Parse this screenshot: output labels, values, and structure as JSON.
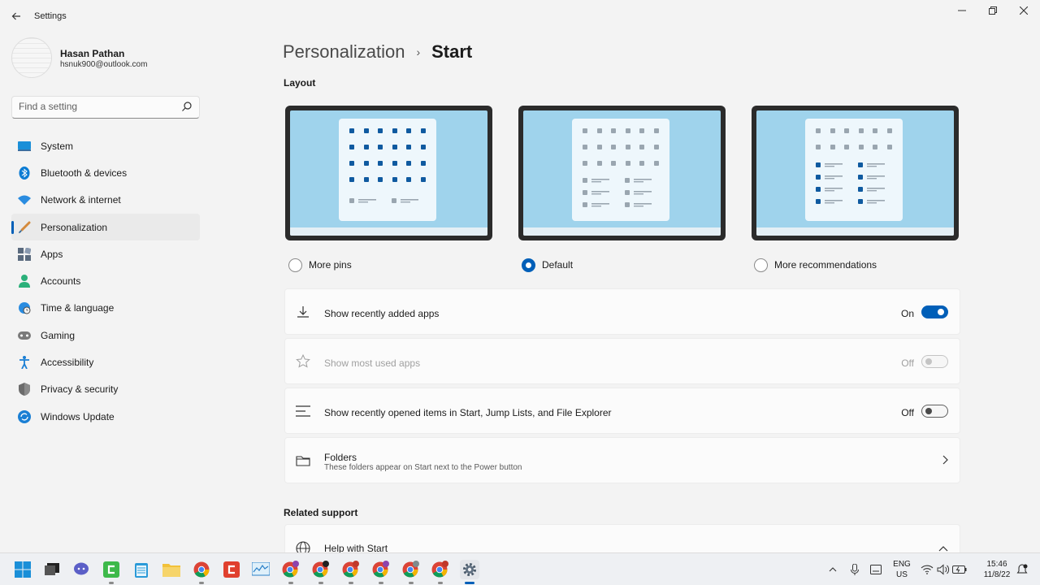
{
  "app": {
    "title": "Settings"
  },
  "profile": {
    "name": "Hasan Pathan",
    "email": "hsnuk900@outlook.com"
  },
  "search": {
    "placeholder": "Find a setting"
  },
  "sidebar": {
    "items": [
      {
        "label": "System",
        "icon": "monitor-icon",
        "color": "#1a8fd8"
      },
      {
        "label": "Bluetooth & devices",
        "icon": "bluetooth-icon",
        "color": "#0a7bd3"
      },
      {
        "label": "Network & internet",
        "icon": "wifi-icon",
        "color": "#2a8ce0"
      },
      {
        "label": "Personalization",
        "icon": "brush-icon",
        "color": "#d48a3c",
        "active": true
      },
      {
        "label": "Apps",
        "icon": "apps-icon",
        "color": "#5a6a7e"
      },
      {
        "label": "Accounts",
        "icon": "person-icon",
        "color": "#2bb07a"
      },
      {
        "label": "Time & language",
        "icon": "globe-clock-icon",
        "color": "#2a8ce0"
      },
      {
        "label": "Gaming",
        "icon": "gamepad-icon",
        "color": "#7a7a7a"
      },
      {
        "label": "Accessibility",
        "icon": "accessibility-icon",
        "color": "#1a7fd4"
      },
      {
        "label": "Privacy & security",
        "icon": "shield-icon",
        "color": "#6b6b6b"
      },
      {
        "label": "Windows Update",
        "icon": "update-icon",
        "color": "#1a7fd4"
      }
    ]
  },
  "breadcrumb": {
    "parent": "Personalization",
    "separator": "›",
    "current": "Start"
  },
  "layout": {
    "heading": "Layout",
    "options": [
      {
        "label": "More pins",
        "selected": false
      },
      {
        "label": "Default",
        "selected": true
      },
      {
        "label": "More recommendations",
        "selected": false
      }
    ]
  },
  "settings": {
    "recent_apps": {
      "label": "Show recently added apps",
      "state": "On",
      "icon": "download-icon"
    },
    "most_used": {
      "label": "Show most used apps",
      "state": "Off",
      "icon": "star-icon"
    },
    "recent_items": {
      "label": "Show recently opened items in Start, Jump Lists, and File Explorer",
      "state": "Off",
      "icon": "list-icon"
    },
    "folders": {
      "label": "Folders",
      "sub": "These folders appear on Start next to the Power button",
      "icon": "folder-icon"
    }
  },
  "related": {
    "heading": "Related support",
    "help_label": "Help with Start"
  },
  "tray": {
    "lang_top": "ENG",
    "lang_bottom": "US",
    "time": "15:46",
    "date": "11/8/22"
  },
  "colors": {
    "accent": "#005fb8",
    "screen": "#9fd3ec"
  }
}
